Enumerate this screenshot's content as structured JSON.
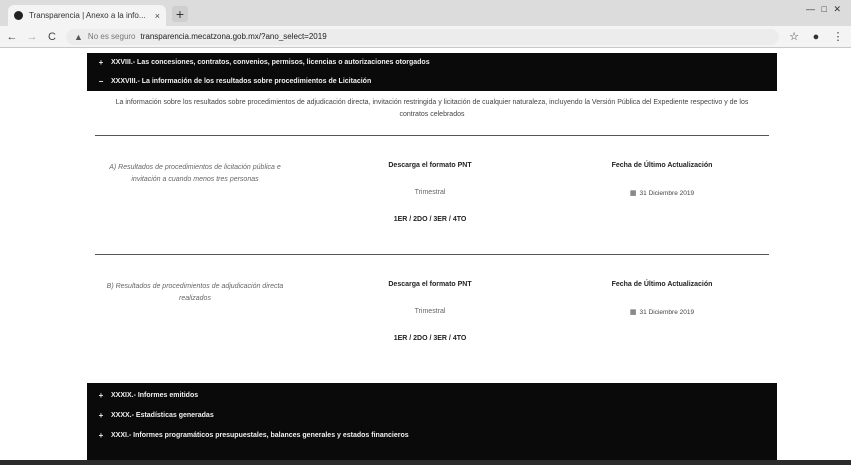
{
  "browser": {
    "tab_title": "Transparencia | Anexo a la info...",
    "tab_close": "×",
    "new_tab": "+",
    "window_controls": "— □ ✕",
    "back": "←",
    "forward": "→",
    "reload": "C",
    "not_secure": "No es seguro",
    "url": "transparencia.mecatzona.gob.mx/?ano_select=2019",
    "star": "☆",
    "account": "●",
    "menu": "⋮"
  },
  "accordion_top": [
    {
      "symbol": "+",
      "label": "XXVIII.- Las concesiones, contratos, convenios, permisos, licencias o autorizaciones otorgados"
    },
    {
      "symbol": "−",
      "label": "XXXVIII.- La información de los resultados sobre procedimientos de Licitación"
    }
  ],
  "intro_text": "La información sobre los resultados sobre procedimientos de adjudicación directa, invitación restringida y licitación de cualquier naturaleza, incluyendo la Versión Pública del Expediente respectivo y de los contratos celebrados",
  "sections": [
    {
      "description": "A) Resultados de procedimientos de licitación pública e invitación a cuando menos tres personas",
      "download_heading": "Descarga el formato PNT",
      "period": "Trimestral",
      "quarters": "1ER / 2DO / 3ER / 4TO",
      "update_heading": "Fecha de Último Actualización",
      "update_date": "31 Diciembre 2019"
    },
    {
      "description": "B) Resultados de procedimientos de adjudicación directa realizados",
      "download_heading": "Descarga el formato PNT",
      "period": "Trimestral",
      "quarters": "1ER / 2DO / 3ER / 4TO",
      "update_heading": "Fecha de Último Actualización",
      "update_date": "31 Diciembre 2019"
    }
  ],
  "accordion_bottom": [
    {
      "symbol": "+",
      "label": "XXXIX.- Informes emitidos"
    },
    {
      "symbol": "+",
      "label": "XXXX.- Estadísticas generadas"
    },
    {
      "symbol": "+",
      "label": "XXXI.- Informes programáticos presupuestales, balances generales y estados financieros"
    }
  ],
  "icons": {
    "calendar": "▦",
    "warning": "▲"
  },
  "colors": {
    "bar_bg": "#0a0a0a",
    "bar_text": "#f0f0f0",
    "page_bg": "#ffffff"
  }
}
